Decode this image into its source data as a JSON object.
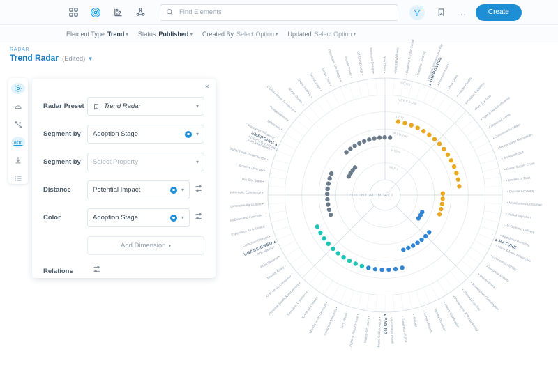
{
  "topbar": {
    "icons": [
      {
        "name": "grid-icon",
        "label": "Grid"
      },
      {
        "name": "radar-icon",
        "label": "Radar"
      },
      {
        "name": "chart-icon",
        "label": "Chart"
      },
      {
        "name": "network-icon",
        "label": "Network"
      }
    ],
    "search": {
      "placeholder": "Find Elements",
      "value": ""
    },
    "filter_label": "Filter",
    "bookmark_label": "Bookmark",
    "more_label": "...",
    "create_label": "Create"
  },
  "filterbar": {
    "element_type_label": "Element Type",
    "element_type_value": "Trend",
    "status_label": "Status",
    "status_value": "Published",
    "created_by_label": "Created By",
    "created_by_value": "Select Option",
    "updated_label": "Updated",
    "updated_value": "Select Option"
  },
  "breadcrumb": {
    "kicker": "RADAR",
    "title": "Trend Radar",
    "edited": "(Edited)"
  },
  "rail": {
    "items": [
      {
        "name": "settings-icon",
        "label": "Settings",
        "selected": true
      },
      {
        "name": "shape-icon",
        "label": "Shape",
        "selected": false
      },
      {
        "name": "connections-icon",
        "label": "Connections",
        "selected": false
      },
      {
        "name": "abc-icon",
        "label": "abc",
        "selected": true
      },
      {
        "name": "download-icon",
        "label": "Download",
        "selected": false
      },
      {
        "name": "list-icon",
        "label": "List",
        "selected": false
      }
    ]
  },
  "panel": {
    "close_label": "×",
    "rows": [
      {
        "label": "Radar Preset",
        "value": "Trend Radar",
        "placeholder": "",
        "italic": true,
        "bookmark": true,
        "clearable": false,
        "slider": false
      },
      {
        "label": "Segment by",
        "value": "Adoption Stage",
        "placeholder": "",
        "italic": false,
        "bookmark": false,
        "clearable": true,
        "slider": false
      },
      {
        "label": "Segment by",
        "value": "",
        "placeholder": "Select Property",
        "italic": false,
        "bookmark": false,
        "clearable": false,
        "slider": false
      },
      {
        "label": "Distance",
        "value": "Potential Impact",
        "placeholder": "",
        "italic": false,
        "bookmark": false,
        "clearable": true,
        "slider": true
      },
      {
        "label": "Color",
        "value": "Adoption Stage",
        "placeholder": "",
        "italic": false,
        "bookmark": false,
        "clearable": true,
        "slider": true
      }
    ],
    "add_dimension_label": "Add Dimension",
    "relations_label": "Relations"
  },
  "chart_data": {
    "type": "radar",
    "title": "Trend Radar",
    "center_label": "POTENTIAL IMPACT",
    "ring_labels": [
      "NONE",
      "VERY LOW",
      "LOW",
      "MEDIUM",
      "HIGH",
      "VERY HIGH"
    ],
    "segment_dimension": "ADOPTION STAGE",
    "segments": [
      {
        "label": "EMERGING",
        "color": "#5b7a99",
        "angle_start": 180,
        "angle_end": 270
      },
      {
        "label": "IMPROVING",
        "color": "#d9a227",
        "angle_start": 270,
        "angle_end": 360
      },
      {
        "label": "MATURE",
        "color": "#d9a227",
        "angle_start": 0,
        "angle_end": 45
      },
      {
        "label": "FADING",
        "color": "#2f86d4",
        "angle_start": 45,
        "angle_end": 135
      },
      {
        "label": "UNASSIGNED",
        "color": "#20bdb0",
        "angle_start": 135,
        "angle_end": 180
      }
    ],
    "colors": {
      "emerging": "#6b7a8a",
      "improving": "#e8a81f",
      "mature": "#e8a81f",
      "fading": "#2f86d4",
      "unassigned": "#20c4b4",
      "grid": "#d7dfe6",
      "label": "#8e9cab"
    },
    "points": [
      {
        "label": "Green Supply Chain",
        "segment": "MATURE",
        "impact": "LOW",
        "color": "#e8a81f"
      },
      {
        "label": "Decline of Trust",
        "segment": "MATURE",
        "impact": "LOW",
        "color": "#e8a81f"
      },
      {
        "label": "Circular Economy",
        "segment": "MATURE",
        "impact": "MEDIUM",
        "color": "#e8a81f"
      },
      {
        "label": "Misinformed Consumer",
        "segment": "MATURE",
        "impact": "MEDIUM",
        "color": "#e8a81f"
      },
      {
        "label": "Global Migration",
        "segment": "MATURE",
        "impact": "MEDIUM",
        "color": "#e8a81f"
      },
      {
        "label": "On-Demand Delivery",
        "segment": "MATURE",
        "impact": "MEDIUM",
        "color": "#e8a81f"
      },
      {
        "label": "Redefined Parenting",
        "segment": "MATURE",
        "impact": "MEDIUM",
        "color": "#e8a81f"
      },
      {
        "label": "Micro & Nano Influencers",
        "segment": "FADING",
        "impact": "HIGH",
        "color": "#2f86d4"
      },
      {
        "label": "Connected Mobility",
        "segment": "FADING",
        "impact": "HIGH",
        "color": "#2f86d4"
      },
      {
        "label": "Alternative Mobility",
        "segment": "FADING",
        "impact": "HIGH",
        "color": "#2f86d4"
      },
      {
        "label": "Womenomics",
        "segment": "FADING",
        "impact": "MEDIUM",
        "color": "#2f86d4"
      },
      {
        "label": "Subscription Consumption",
        "segment": "FADING",
        "impact": "MEDIUM",
        "color": "#2f86d4"
      },
      {
        "label": "Sharing Economy",
        "segment": "FADING",
        "impact": "MEDIUM",
        "color": "#2f86d4"
      },
      {
        "label": "Provenance & Transparency",
        "segment": "FADING",
        "impact": "MEDIUM",
        "color": "#2f86d4"
      },
      {
        "label": "Instant Gratification",
        "segment": "FADING",
        "impact": "MEDIUM",
        "color": "#2f86d4"
      },
      {
        "label": "Identity Pluralism",
        "segment": "FADING",
        "impact": "MEDIUM",
        "color": "#2f86d4"
      },
      {
        "label": "Human Brands",
        "segment": "FADING",
        "impact": "MEDIUM",
        "color": "#2f86d4"
      },
      {
        "label": "Heritage",
        "segment": "FADING",
        "impact": "LOW",
        "color": "#2f86d4"
      },
      {
        "label": "Generation Alpha",
        "segment": "FADING",
        "impact": "LOW",
        "color": "#2f86d4"
      },
      {
        "label": "Automated Retail",
        "segment": "FADING",
        "impact": "LOW",
        "color": "#2f86d4"
      },
      {
        "label": "Brand Collaboration",
        "segment": "FADING",
        "impact": "LOW",
        "color": "#2f86d4"
      },
      {
        "label": "Walled-Art Luxury",
        "segment": "FADING",
        "impact": "LOW",
        "color": "#2f86d4"
      },
      {
        "label": "Fighting Plastic Waste",
        "segment": "FADING",
        "impact": "LOW",
        "color": "#2f86d4"
      },
      {
        "label": "Zero Waste",
        "segment": "FADING",
        "impact": "LOW",
        "color": "#20c4b4"
      },
      {
        "label": "Conscious Materials",
        "segment": "UNASSIGNED",
        "impact": "LOW",
        "color": "#20c4b4"
      },
      {
        "label": "Workforce-On-Demand",
        "segment": "UNASSIGNED",
        "impact": "LOW",
        "color": "#20c4b4"
      },
      {
        "label": "Too Much Choice",
        "segment": "UNASSIGNED",
        "impact": "LOW",
        "color": "#20c4b4"
      },
      {
        "label": "Seamless Commerce",
        "segment": "UNASSIGNED",
        "impact": "LOW",
        "color": "#20c4b4"
      },
      {
        "label": "Proactive Health Enforcement",
        "segment": "UNASSIGNED",
        "impact": "LOW",
        "color": "#20c4b4"
      },
      {
        "label": "On-The-Go Consumer",
        "segment": "UNASSIGNED",
        "impact": "LOW",
        "color": "#20c4b4"
      },
      {
        "label": "Mobility Ability",
        "segment": "UNASSIGNED",
        "impact": "LOW",
        "color": "#20c4b4"
      },
      {
        "label": "Food Security",
        "segment": "UNASSIGNED",
        "impact": "LOW",
        "color": "#20c4b4"
      },
      {
        "label": "Anti-Ageing",
        "segment": "UNASSIGNED",
        "impact": "LOW",
        "color": "#20c4b4"
      },
      {
        "label": "Consumer Citizens",
        "segment": "EMERGING",
        "impact": "MEDIUM",
        "color": "#6b7a8a"
      },
      {
        "label": "Experience As A Service",
        "segment": "EMERGING",
        "impact": "MEDIUM",
        "color": "#6b7a8a"
      },
      {
        "label": "Global Economic Insecurity",
        "segment": "EMERGING",
        "impact": "MEDIUM",
        "color": "#6b7a8a"
      },
      {
        "label": "Regenerative Agriculture",
        "segment": "EMERGING",
        "impact": "MEDIUM",
        "color": "#6b7a8a"
      },
      {
        "label": "Programmatic Commerce",
        "segment": "EMERGING",
        "impact": "MEDIUM",
        "color": "#6b7a8a"
      },
      {
        "label": "The City State",
        "segment": "EMERGING",
        "impact": "MEDIUM",
        "color": "#6b7a8a"
      },
      {
        "label": "Inclusive Diversity",
        "segment": "EMERGING",
        "impact": "MEDIUM",
        "color": "#6b7a8a"
      },
      {
        "label": "Global Trade Protectionism",
        "segment": "EMERGING",
        "impact": "MEDIUM",
        "color": "#6b7a8a"
      },
      {
        "label": "Fuel Alternatives",
        "segment": "EMERGING",
        "impact": "MEDIUM",
        "color": "#6b7a8a"
      },
      {
        "label": "Coronavirus Pandemic",
        "segment": "EMERGING",
        "impact": "HIGH",
        "color": "#6b7a8a"
      },
      {
        "label": "Millennials",
        "segment": "EMERGING",
        "impact": "HIGH",
        "color": "#6b7a8a"
      },
      {
        "label": "Postgenderism",
        "segment": "EMERGING",
        "impact": "HIGH",
        "color": "#6b7a8a"
      },
      {
        "label": "Global Access To Internet",
        "segment": "EMERGING",
        "impact": "HIGH",
        "color": "#6b7a8a"
      },
      {
        "label": "Status Stories",
        "segment": "EMERGING",
        "impact": "MEDIUM",
        "color": "#6b7a8a"
      },
      {
        "label": "Space Scarcity",
        "segment": "EMERGING",
        "impact": "MEDIUM",
        "color": "#6b7a8a"
      },
      {
        "label": "Social Divide",
        "segment": "EMERGING",
        "impact": "MEDIUM",
        "color": "#6b7a8a"
      },
      {
        "label": "Smart Cities",
        "segment": "EMERGING",
        "impact": "MEDIUM",
        "color": "#6b7a8a"
      },
      {
        "label": "Perishable Life Stages",
        "segment": "IMPROVING",
        "impact": "MEDIUM",
        "color": "#6b7a8a"
      },
      {
        "label": "People Power",
        "segment": "IMPROVING",
        "impact": "MEDIUM",
        "color": "#6b7a8a"
      },
      {
        "label": "Off-Grid Energy",
        "segment": "IMPROVING",
        "impact": "MEDIUM",
        "color": "#6b7a8a"
      },
      {
        "label": "Normcore Design",
        "segment": "IMPROVING",
        "impact": "MEDIUM",
        "color": "#6b7a8a"
      },
      {
        "label": "New Class",
        "segment": "IMPROVING",
        "impact": "MEDIUM",
        "color": "#6b7a8a"
      },
      {
        "label": "Natural Wellness",
        "segment": "IMPROVING",
        "impact": "MEDIUM",
        "color": "#6b7a8a"
      },
      {
        "label": "Declining Trust in Social",
        "segment": "IMPROVING",
        "impact": "LOW",
        "color": "#e8a81f"
      },
      {
        "label": "Transport Sharing",
        "segment": "IMPROVING",
        "impact": "LOW",
        "color": "#e8a81f"
      },
      {
        "label": "Western Entrepreneurship",
        "segment": "IMPROVING",
        "impact": "LOW",
        "color": "#e8a81f"
      },
      {
        "label": "Premiumisation",
        "segment": "IMPROVING",
        "impact": "LOW",
        "color": "#e8a81f"
      },
      {
        "label": "Meta Cities",
        "segment": "IMPROVING",
        "impact": "LOW",
        "color": "#e8a81f"
      },
      {
        "label": "Gender Fluidity",
        "segment": "IMPROVING",
        "impact": "LOW",
        "color": "#e8a81f"
      },
      {
        "label": "Positive Rebellion",
        "segment": "MATURE",
        "impact": "LOW",
        "color": "#e8a81f"
      },
      {
        "label": "From The Side",
        "segment": "MATURE",
        "impact": "LOW",
        "color": "#e8a81f"
      },
      {
        "label": "Ageing Market Influence",
        "segment": "MATURE",
        "impact": "LOW",
        "color": "#e8a81f"
      },
      {
        "label": "Connected Home",
        "segment": "MATURE",
        "impact": "LOW",
        "color": "#e8a81f"
      },
      {
        "label": "Consumer As Maker",
        "segment": "MATURE",
        "impact": "LOW",
        "color": "#e8a81f"
      },
      {
        "label": "Meaningless Mainstream",
        "segment": "MATURE",
        "impact": "LOW",
        "color": "#e8a81f"
      },
      {
        "label": "Broadcast Self",
        "segment": "MATURE",
        "impact": "LOW",
        "color": "#e8a81f"
      }
    ]
  }
}
